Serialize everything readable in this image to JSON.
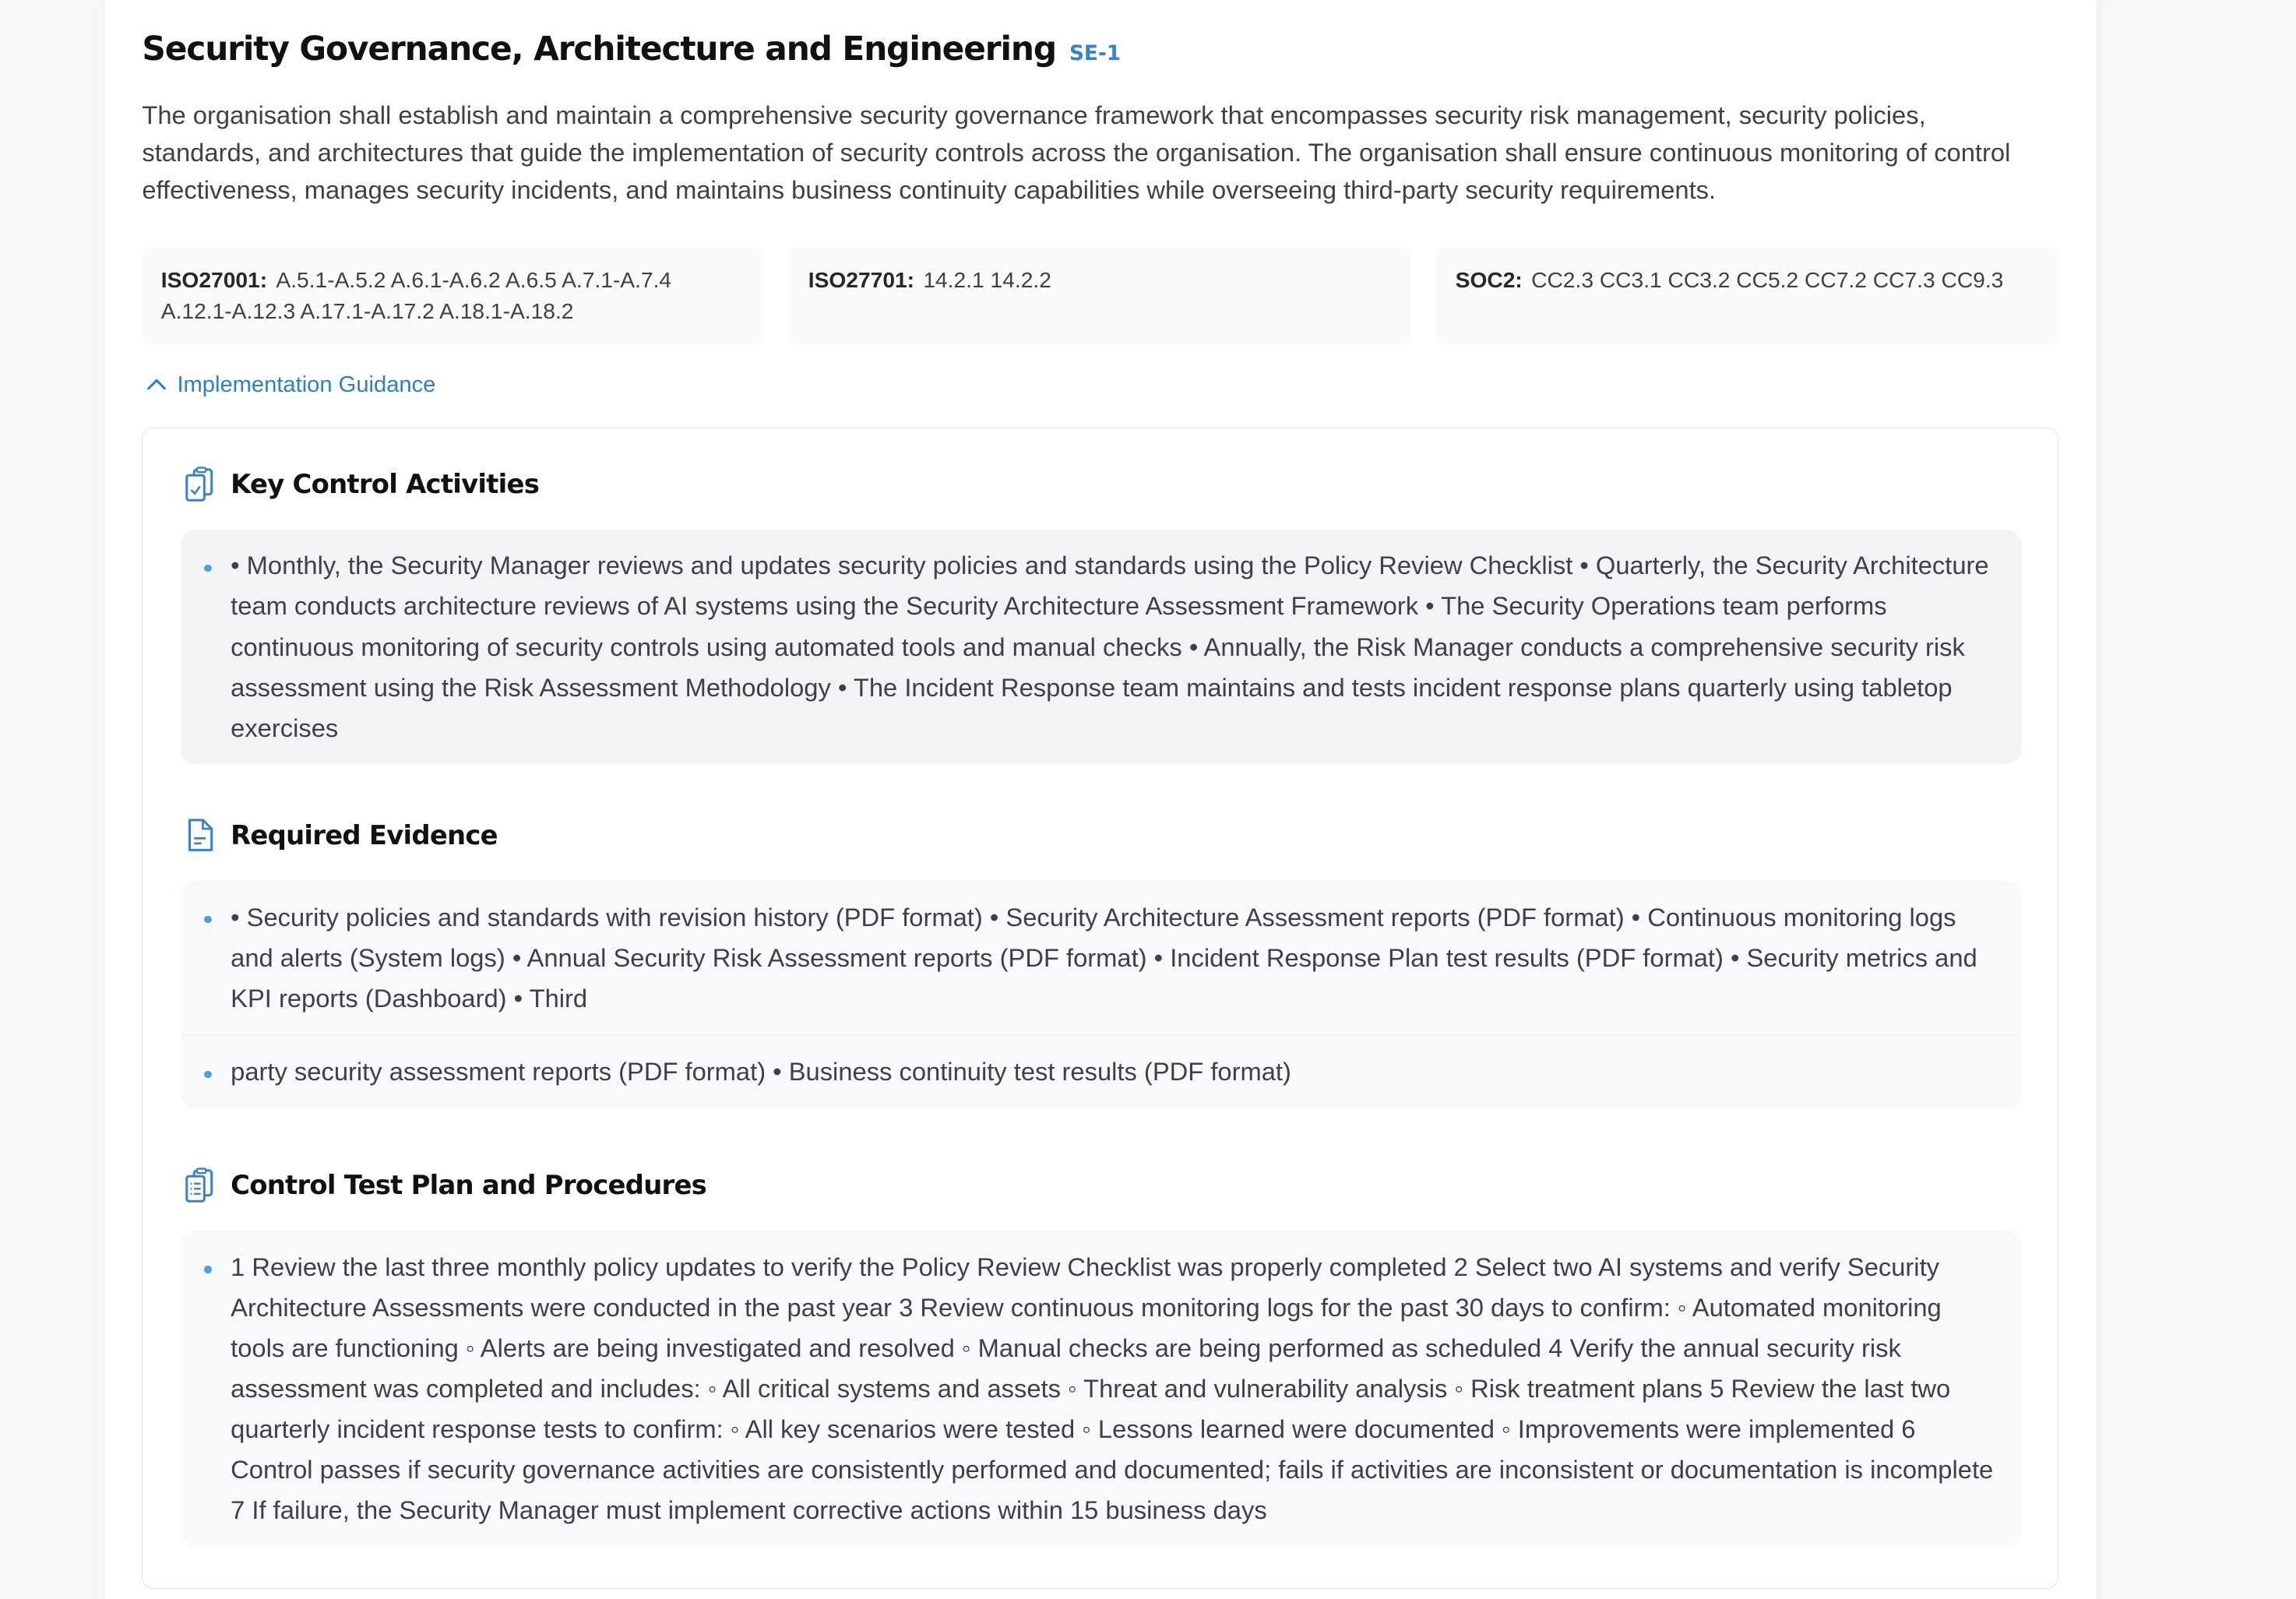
{
  "control": {
    "title": "Security Governance, Architecture and Engineering",
    "code": "SE-1",
    "description": "The organisation shall establish and maintain a comprehensive security governance framework that encompasses security risk management, security policies, standards, and architectures that guide the implementation of security controls across the organisation. The organisation shall ensure continuous monitoring of control effectiveness, manages security incidents, and maintains business continuity capabilities while overseeing third-party security requirements."
  },
  "references": [
    {
      "label": "ISO27001:",
      "value": "A.5.1-A.5.2 A.6.1-A.6.2 A.6.5 A.7.1-A.7.4 A.12.1-A.12.3 A.17.1-A.17.2 A.18.1-A.18.2"
    },
    {
      "label": "ISO27701:",
      "value": "14.2.1 14.2.2"
    },
    {
      "label": "SOC2:",
      "value": "CC2.3 CC3.1 CC3.2 CC5.2 CC7.2 CC7.3 CC9.3"
    }
  ],
  "guidance": {
    "toggle_label": "Implementation Guidance",
    "icon": "chevron-up-icon",
    "accent": "#2f7fc1",
    "sections": [
      {
        "title": "Key Control Activities",
        "icon": "clipboard-check-icon",
        "items": [
          "• Monthly, the Security Manager reviews and updates security policies and standards using the Policy Review Checklist • Quarterly, the Security Architecture team conducts architecture reviews of AI systems using the Security Architecture Assessment Framework • The Security Operations team performs continuous monitoring of security controls using automated tools and manual checks • Annually, the Risk Manager conducts a comprehensive security risk assessment using the Risk Assessment Methodology • The Incident Response team maintains and tests incident response plans quarterly using tabletop exercises"
        ]
      },
      {
        "title": "Required Evidence",
        "icon": "document-icon",
        "items": [
          "• Security policies and standards with revision history (PDF format) • Security Architecture Assessment reports (PDF format) • Continuous monitoring logs and alerts (System logs) • Annual Security Risk Assessment reports (PDF format) • Incident Response Plan test results (PDF format) • Security metrics and KPI reports (Dashboard) • Third",
          "party security assessment reports (PDF format) • Business continuity test results (PDF format)"
        ]
      },
      {
        "title": "Control Test Plan and Procedures",
        "icon": "clipboard-list-icon",
        "items": [
          "1 Review the last three monthly policy updates to verify the Policy Review Checklist was properly completed 2 Select two AI systems and verify Security Architecture Assessments were conducted in the past year 3 Review continuous monitoring logs for the past 30 days to confirm: ◦ Automated monitoring tools are functioning ◦ Alerts are being investigated and resolved ◦ Manual checks are being performed as scheduled 4 Verify the annual security risk assessment was completed and includes: ◦ All critical systems and assets ◦ Threat and vulnerability analysis ◦ Risk treatment plans 5 Review the last two quarterly incident response tests to confirm: ◦ All key scenarios were tested ◦ Lessons learned were documented ◦ Improvements were implemented 6 Control passes if security governance activities are consistently performed and documented; fails if activities are inconsistent or documentation is incomplete 7 If failure, the Security Manager must implement corrective actions within 15 business days"
        ]
      }
    ]
  }
}
